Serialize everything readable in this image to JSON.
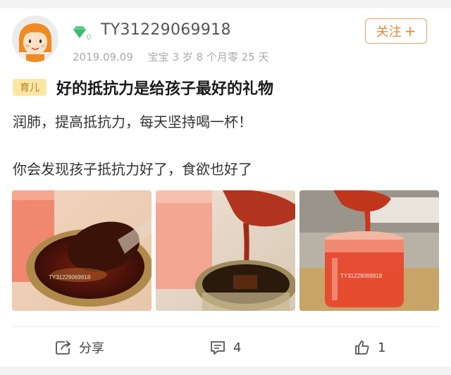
{
  "user": {
    "name": "TY31229069918",
    "date": "2019.09.09",
    "baby_age": "宝宝 3 岁 8 个月零 25 天",
    "vip_level": "0"
  },
  "follow_button": {
    "label": "关注",
    "plus": "+"
  },
  "post": {
    "tag": "育儿",
    "title": "好的抵抗力是给孩子最好的礼物",
    "lines": [
      "润肺，提高抵抗力，每天坚持喝一杯！",
      "你会发现孩子抵抗力好了，食欲也好了"
    ],
    "watermarks": [
      "TY31229069918",
      "TY31229069918"
    ]
  },
  "actions": {
    "share_label": "分享",
    "comment_count": "4",
    "like_count": "1"
  },
  "colors": {
    "accent": "#e08a3c",
    "tag_bg": "#fbe7a4",
    "vip": "#5ccf8e"
  }
}
